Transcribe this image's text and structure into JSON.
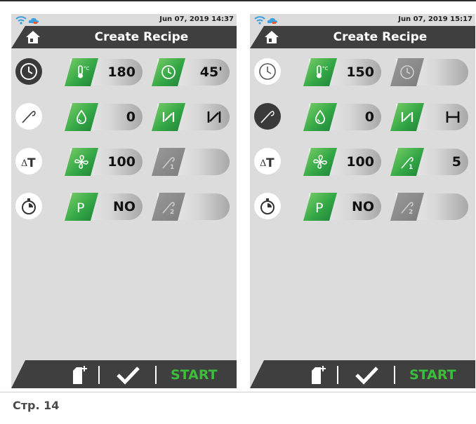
{
  "screens": [
    {
      "date": "Jun 07, 2019  14:37",
      "title": "Create Recipe",
      "temperature": "180",
      "time": "45'",
      "humidity": "0",
      "fan": "100",
      "preheat": "NO",
      "start_label": "START"
    },
    {
      "date": "Jun 07, 2019  15:17",
      "title": "Create Recipe",
      "temperature": "150",
      "time": "",
      "humidity": "0",
      "fan": "100",
      "probe1": "5",
      "preheat": "NO",
      "start_label": "START"
    }
  ],
  "caption": "Стр. 14",
  "colors": {
    "accent_green": "#3cbe3c",
    "header": "#3f3f3f",
    "screen_bg": "#dcdcdc"
  }
}
